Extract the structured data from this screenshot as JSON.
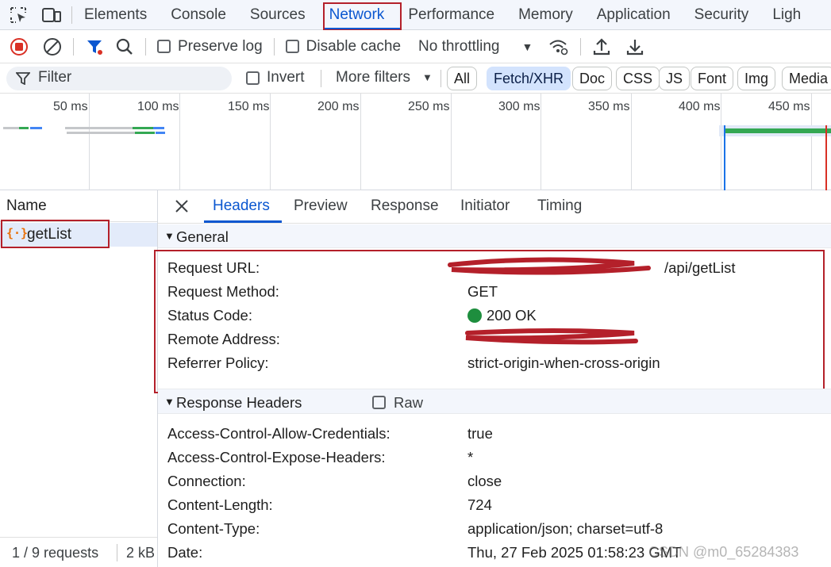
{
  "tabbar": {
    "tabs": [
      "Elements",
      "Console",
      "Sources",
      "Network",
      "Performance",
      "Memory",
      "Application",
      "Security",
      "Ligh"
    ],
    "active": "Network"
  },
  "toolbar": {
    "preserve_log": "Preserve log",
    "disable_cache": "Disable cache",
    "throttling": "No throttling"
  },
  "filterbar": {
    "filter_placeholder": "Filter",
    "invert": "Invert",
    "more_filters": "More filters",
    "chips": [
      "All",
      "Fetch/XHR",
      "Doc",
      "CSS",
      "JS",
      "Font",
      "Img",
      "Media"
    ],
    "selected_chip": "Fetch/XHR"
  },
  "overview": {
    "ticks": [
      "50 ms",
      "100 ms",
      "150 ms",
      "200 ms",
      "250 ms",
      "300 ms",
      "350 ms",
      "400 ms",
      "450 ms"
    ]
  },
  "requests": {
    "column_name": "Name",
    "items": [
      {
        "name": "getList"
      }
    ],
    "footer_count": "1 / 9 requests",
    "footer_size": "2 kB"
  },
  "details": {
    "tabs": [
      "Headers",
      "Preview",
      "Response",
      "Initiator",
      "Timing"
    ],
    "active_tab": "Headers",
    "general": {
      "title": "General",
      "rows": [
        {
          "key": "Request URL:",
          "value": "http://192.168.182.131:8081/api/getList",
          "visible_value": "/api/getList"
        },
        {
          "key": "Request Method:",
          "value": "GET"
        },
        {
          "key": "Status Code:",
          "value": "200 OK"
        },
        {
          "key": "Remote Address:",
          "value": ""
        },
        {
          "key": "Referrer Policy:",
          "value": "strict-origin-when-cross-origin"
        }
      ]
    },
    "response_headers": {
      "title": "Response Headers",
      "raw_label": "Raw",
      "rows": [
        {
          "key": "Access-Control-Allow-Credentials:",
          "value": "true"
        },
        {
          "key": "Access-Control-Expose-Headers:",
          "value": "*"
        },
        {
          "key": "Connection:",
          "value": "close"
        },
        {
          "key": "Content-Length:",
          "value": "724"
        },
        {
          "key": "Content-Type:",
          "value": "application/json; charset=utf-8"
        },
        {
          "key": "Date:",
          "value": "Thu, 27 Feb 2025 01:58:23 GMT"
        }
      ]
    }
  },
  "watermark": "CSDN @m0_65284383",
  "colors": {
    "accent": "#0b57d0",
    "status_ok": "#1e8e3e",
    "annotation_red": "#b4202a"
  }
}
